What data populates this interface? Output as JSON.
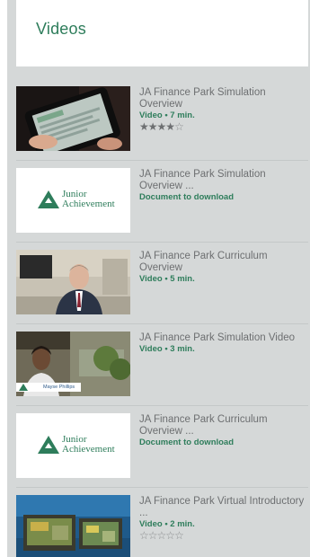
{
  "header": {
    "title": "Videos"
  },
  "items": [
    {
      "title": "JA Finance Park Simulation Overview",
      "meta": "Video • 7 min.",
      "thumb": "tablet-hands",
      "rating": 4
    },
    {
      "title": "JA Finance Park Simulation Overview ...",
      "meta": "Document to download",
      "thumb": "ja-logo"
    },
    {
      "title": "JA Finance Park Curriculum Overview",
      "meta": "Video • 5 min.",
      "thumb": "man-presenter"
    },
    {
      "title": "JA Finance Park Simulation Video",
      "meta": "Video • 3 min.",
      "thumb": "woman-lobby",
      "caption": "Mayse Phillips"
    },
    {
      "title": "JA Finance Park Curriculum Overview ...",
      "meta": "Document to download",
      "thumb": "ja-logo"
    },
    {
      "title": "JA Finance Park Virtual Introductory ...",
      "meta": "Video • 2 min.",
      "thumb": "virtual-screens",
      "rating": 0
    }
  ],
  "logo": {
    "line1": "Junior",
    "line2": "Achievement",
    "mark": "™"
  },
  "colors": {
    "accent": "#2e7d5b",
    "text": "#6d6f71",
    "panel": "#d5d8d8"
  }
}
